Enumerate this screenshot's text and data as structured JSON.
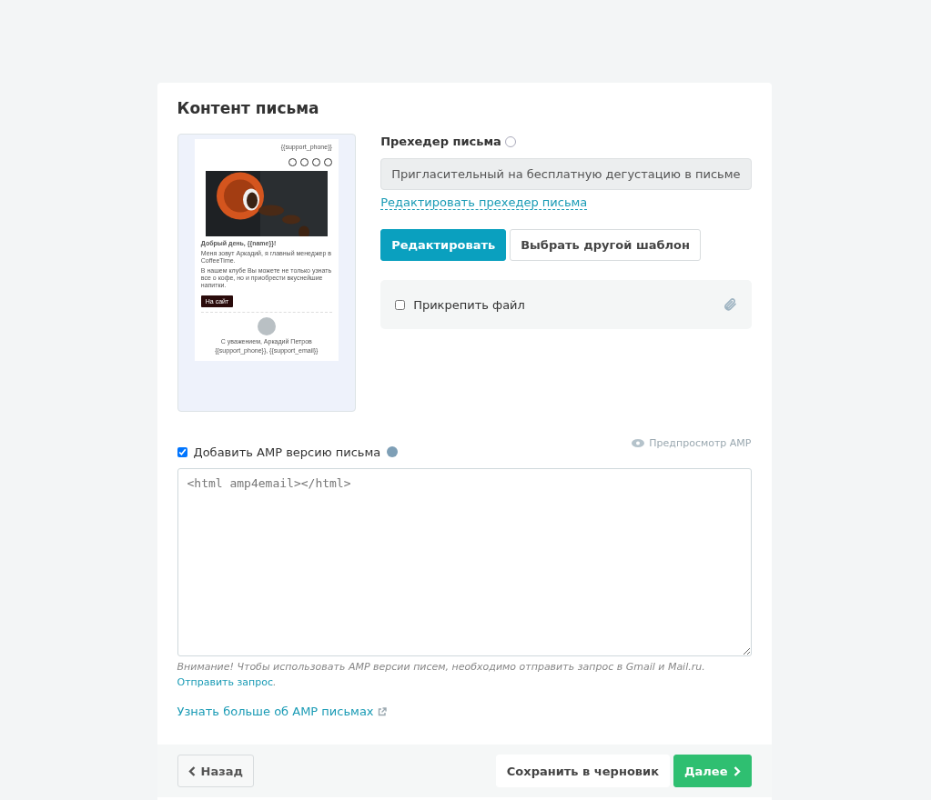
{
  "title": "Контент письма",
  "preview": {
    "phone": "{{support_phone}}",
    "greeting": "Добрый день, {{name}}!",
    "paragraphs": [
      "Меня зовут Аркадий, я главный менеджер в CoffeeTime.",
      "В нашем клубе Вы можете не только узнать все о кофе, но и приобрести вкуснейшие напитки."
    ],
    "button": "На сайт",
    "signature": "С уважением, Аркадий Петров",
    "contacts": "{{support_phone}}, {{support_email}}"
  },
  "preheader": {
    "label": "Прехедер письма",
    "value": "Пригласительный на бесплатную дегустацию в письме",
    "edit_link": "Редактировать прехедер письма"
  },
  "actions": [
    {
      "label": "Редактировать",
      "kind": "primary"
    },
    {
      "label": "Выбрать другой шаблон",
      "kind": "secondary"
    }
  ],
  "attach": {
    "label": "Прикрепить файл",
    "checked": false
  },
  "amp": {
    "label": "Добавить AMP версию письма",
    "checked": true,
    "preview_link": "Предпросмотр AMP",
    "code": "<html amp4email></html>",
    "notice": "Внимание! Чтобы использовать AMP версии писем, необходимо отправить запрос в Gmail и Mail.ru.",
    "notice_link": "Отправить запрос",
    "notice_end": ".",
    "learn_more": "Узнать больше об AMP письмах"
  },
  "footer": {
    "back": "Назад",
    "save": "Сохранить в черновик",
    "next": "Далее"
  }
}
